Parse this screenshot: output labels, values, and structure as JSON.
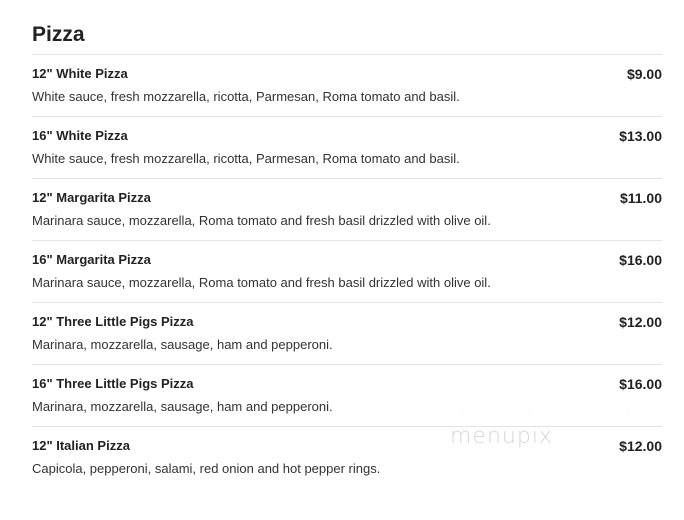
{
  "section": {
    "title": "Pizza"
  },
  "items": [
    {
      "name": "12\" White Pizza",
      "price": "$9.00",
      "description": "White sauce, fresh mozzarella, ricotta, Parmesan, Roma tomato and basil."
    },
    {
      "name": "16\" White Pizza",
      "price": "$13.00",
      "description": "White sauce, fresh mozzarella, ricotta, Parmesan, Roma tomato and basil."
    },
    {
      "name": "12\" Margarita Pizza",
      "price": "$11.00",
      "description": "Marinara sauce, mozzarella, Roma tomato and fresh basil drizzled with olive oil."
    },
    {
      "name": "16\" Margarita Pizza",
      "price": "$16.00",
      "description": "Marinara sauce, mozzarella, Roma tomato and fresh basil drizzled with olive oil."
    },
    {
      "name": "12\" Three Little Pigs Pizza",
      "price": "$12.00",
      "description": "Marinara, mozzarella, sausage, ham and pepperoni."
    },
    {
      "name": "16\" Three Little Pigs Pizza",
      "price": "$16.00",
      "description": "Marinara, mozzarella, sausage, ham and pepperoni."
    },
    {
      "name": "12\" Italian Pizza",
      "price": "$12.00",
      "description": "Capicola, pepperoni, salami, red onion and hot pepper rings."
    }
  ],
  "watermark": {
    "text": "menupix"
  }
}
